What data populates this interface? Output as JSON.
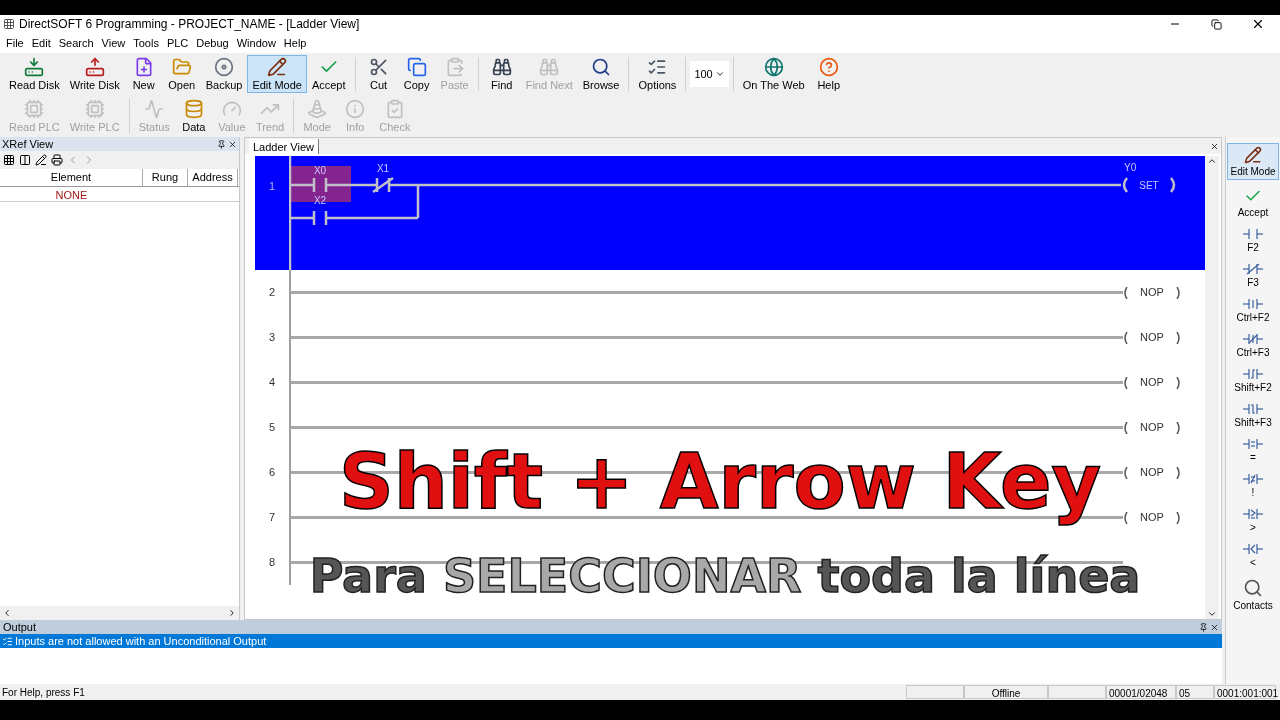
{
  "window": {
    "title": "DirectSOFT 6 Programming - PROJECT_NAME - [Ladder View]"
  },
  "menu": [
    "File",
    "Edit",
    "Search",
    "View",
    "Tools",
    "PLC",
    "Debug",
    "Window",
    "Help"
  ],
  "toolbar_1": [
    {
      "label": "Read Disk",
      "disabled": false,
      "selected": false
    },
    {
      "label": "Write Disk",
      "disabled": false,
      "selected": false
    },
    {
      "label": "New",
      "disabled": false,
      "selected": false
    },
    {
      "label": "Open",
      "disabled": false,
      "selected": false
    },
    {
      "label": "Backup",
      "disabled": false,
      "selected": false
    },
    {
      "label": "Edit Mode",
      "disabled": false,
      "selected": true
    },
    {
      "label": "Accept",
      "disabled": false,
      "selected": false
    },
    {
      "label": "Cut",
      "disabled": false,
      "selected": false
    },
    {
      "label": "Copy",
      "disabled": false,
      "selected": false
    },
    {
      "label": "Paste",
      "disabled": true,
      "selected": false
    },
    {
      "label": "Find",
      "disabled": false,
      "selected": false
    },
    {
      "label": "Find Next",
      "disabled": true,
      "selected": false
    },
    {
      "label": "Browse",
      "disabled": false,
      "selected": false
    },
    {
      "label": "Options",
      "disabled": false,
      "selected": false
    }
  ],
  "zoom": {
    "value": "100"
  },
  "toolbar_1_end": [
    {
      "label": "On The Web",
      "disabled": false,
      "selected": false
    },
    {
      "label": "Help",
      "disabled": false,
      "selected": false
    }
  ],
  "toolbar_2": [
    {
      "label": "Read PLC",
      "disabled": true
    },
    {
      "label": "Write PLC",
      "disabled": true
    },
    {
      "label": "Status",
      "disabled": true
    },
    {
      "label": "Data",
      "disabled": false
    },
    {
      "label": "Value",
      "disabled": true
    },
    {
      "label": "Trend",
      "disabled": true
    },
    {
      "label": "Mode",
      "disabled": true
    },
    {
      "label": "Info",
      "disabled": true
    },
    {
      "label": "Check",
      "disabled": true
    }
  ],
  "xref": {
    "title": "XRef View",
    "columns": [
      "Element",
      "Rung",
      "Address"
    ],
    "rows": [
      [
        "NONE"
      ]
    ]
  },
  "ladder": {
    "tab": "Ladder View",
    "rungs": [
      {
        "number": "1",
        "selected": true,
        "contacts": [
          {
            "label": "X0",
            "kind": "no"
          },
          {
            "label": "X1",
            "kind": "nc"
          },
          {
            "label": "X2",
            "kind": "no"
          }
        ],
        "coil": "Y0",
        "output": "SET"
      },
      {
        "number": "2",
        "selected": false,
        "output": "NOP"
      },
      {
        "number": "3",
        "selected": false,
        "output": "NOP"
      },
      {
        "number": "4",
        "selected": false,
        "output": "NOP"
      },
      {
        "number": "5",
        "selected": false,
        "output": "NOP"
      },
      {
        "number": "6",
        "selected": false,
        "output": "NOP"
      },
      {
        "number": "7",
        "selected": false,
        "output": "NOP"
      },
      {
        "number": "8",
        "selected": false
      }
    ]
  },
  "palette": [
    {
      "label": "Edit Mode",
      "kind": "edit",
      "selected": true
    },
    {
      "label": "Accept",
      "kind": "accept",
      "selected": false
    },
    {
      "label": "F2",
      "kind": "no",
      "selected": false
    },
    {
      "label": "F3",
      "kind": "nc",
      "selected": false
    },
    {
      "label": "Ctrl+F2",
      "kind": "imm",
      "selected": false
    },
    {
      "label": "Ctrl+F3",
      "kind": "immnc",
      "selected": false
    },
    {
      "label": "Shift+F2",
      "kind": "rise",
      "selected": false
    },
    {
      "label": "Shift+F3",
      "kind": "fall",
      "selected": false
    },
    {
      "label": "=",
      "kind": "eq",
      "selected": false
    },
    {
      "label": "!",
      "kind": "neq",
      "selected": false
    },
    {
      "label": ">",
      "kind": "ge",
      "selected": false
    },
    {
      "label": "<",
      "kind": "lt",
      "selected": false
    },
    {
      "label": "Contacts",
      "kind": "browse",
      "selected": false
    }
  ],
  "output": {
    "title": "Output",
    "messages": [
      {
        "text": "Inputs are not allowed with an Unconditional Output",
        "selected": true
      }
    ]
  },
  "status_bar": {
    "help": "For Help, press F1",
    "fields": [
      "Offline",
      "00001/02048",
      "05",
      "0001:001:001"
    ]
  },
  "caption": {
    "line_1": "Shift + Arrow Key",
    "line_2": [
      {
        "text": "Para ",
        "highlight": false
      },
      {
        "text": "SELECCIONAR",
        "highlight": true
      },
      {
        "text": " toda la línea",
        "highlight": false
      }
    ]
  }
}
